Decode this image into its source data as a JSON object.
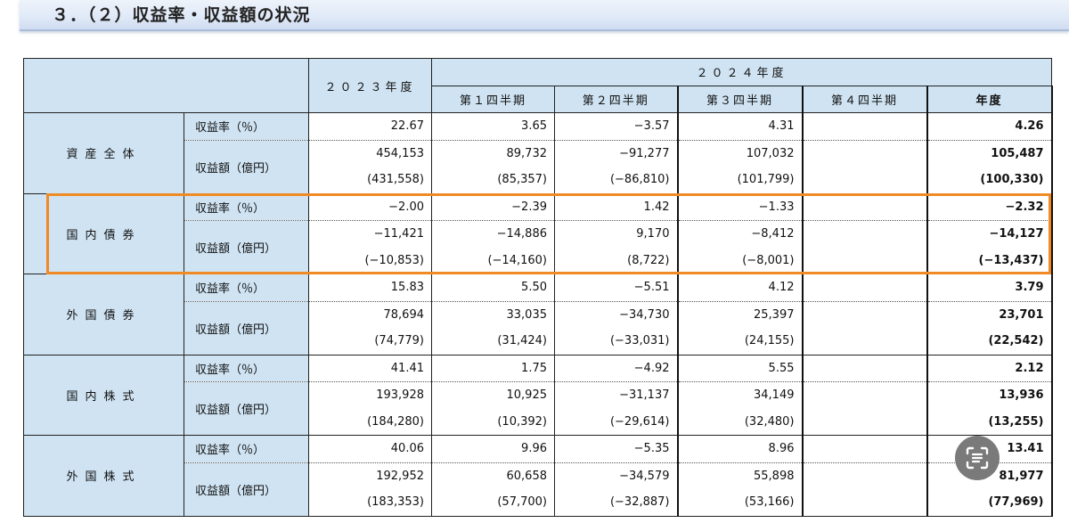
{
  "title": "３．（２）収益率・収益額の状況",
  "header": {
    "fy2023": "２０２３年度",
    "fy2024": "２０２４年度",
    "q1": "第１四半期",
    "q2": "第２四半期",
    "q3": "第３四半期",
    "q4": "第４四半期",
    "annual": "年度"
  },
  "metric_labels": {
    "rate": "収益率（％）",
    "amount": "収益額（億円）"
  },
  "rows": [
    {
      "category": "資産全体",
      "rate": [
        "22.67",
        "3.65",
        "−3.57",
        "4.31",
        "",
        "4.26"
      ],
      "amount": [
        "454,153",
        "89,732",
        "−91,277",
        "107,032",
        "",
        "105,487"
      ],
      "amount_alt": [
        "(431,558)",
        "(85,357)",
        "(−86,810)",
        "(101,799)",
        "",
        "(100,330)"
      ]
    },
    {
      "category": "国内債券",
      "rate": [
        "−2.00",
        "−2.39",
        "1.42",
        "−1.33",
        "",
        "−2.32"
      ],
      "amount": [
        "−11,421",
        "−14,886",
        "9,170",
        "−8,412",
        "",
        "−14,127"
      ],
      "amount_alt": [
        "(−10,853)",
        "(−14,160)",
        "(8,722)",
        "(−8,001)",
        "",
        "(−13,437)"
      ]
    },
    {
      "category": "外国債券",
      "rate": [
        "15.83",
        "5.50",
        "−5.51",
        "4.12",
        "",
        "3.79"
      ],
      "amount": [
        "78,694",
        "33,035",
        "−34,730",
        "25,397",
        "",
        "23,701"
      ],
      "amount_alt": [
        "(74,779)",
        "(31,424)",
        "(−33,031)",
        "(24,155)",
        "",
        "(22,542)"
      ]
    },
    {
      "category": "国内株式",
      "rate": [
        "41.41",
        "1.75",
        "−4.92",
        "5.55",
        "",
        "2.12"
      ],
      "amount": [
        "193,928",
        "10,925",
        "−31,137",
        "34,149",
        "",
        "13,936"
      ],
      "amount_alt": [
        "(184,280)",
        "(10,392)",
        "(−29,614)",
        "(32,480)",
        "",
        "(13,255)"
      ]
    },
    {
      "category": "外国株式",
      "rate": [
        "40.06",
        "9.96",
        "−5.35",
        "8.96",
        "",
        "13.41"
      ],
      "amount": [
        "192,952",
        "60,658",
        "−34,579",
        "55,898",
        "",
        "81,977"
      ],
      "amount_alt": [
        "(183,353)",
        "(57,700)",
        "(−32,887)",
        "(53,166)",
        "",
        "(77,969)"
      ]
    }
  ],
  "icons": {
    "scan": "text-scan-icon"
  },
  "colors": {
    "header_bg": "#cfe3f2",
    "highlight": "#f08a24"
  }
}
